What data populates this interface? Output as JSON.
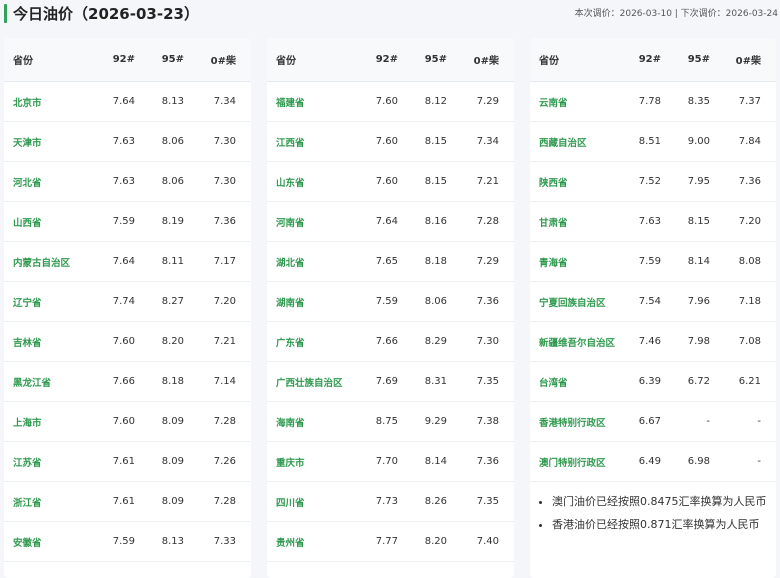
{
  "header": {
    "title": "今日油价（2026-03-23）",
    "adjust_info": "本次调价：2026-03-10 | 下次调价：2026-03-24"
  },
  "columns": {
    "province": "省份",
    "p92": "92#",
    "p95": "95#",
    "p0": "0#柴"
  },
  "tables": [
    {
      "rows": [
        {
          "province": "北京市",
          "p92": "7.64",
          "p95": "8.13",
          "p0": "7.34"
        },
        {
          "province": "天津市",
          "p92": "7.63",
          "p95": "8.06",
          "p0": "7.30"
        },
        {
          "province": "河北省",
          "p92": "7.63",
          "p95": "8.06",
          "p0": "7.30"
        },
        {
          "province": "山西省",
          "p92": "7.59",
          "p95": "8.19",
          "p0": "7.36"
        },
        {
          "province": "内蒙古自治区",
          "p92": "7.64",
          "p95": "8.11",
          "p0": "7.17"
        },
        {
          "province": "辽宁省",
          "p92": "7.74",
          "p95": "8.27",
          "p0": "7.20"
        },
        {
          "province": "吉林省",
          "p92": "7.60",
          "p95": "8.20",
          "p0": "7.21"
        },
        {
          "province": "黑龙江省",
          "p92": "7.66",
          "p95": "8.18",
          "p0": "7.14"
        },
        {
          "province": "上海市",
          "p92": "7.60",
          "p95": "8.09",
          "p0": "7.28"
        },
        {
          "province": "江苏省",
          "p92": "7.61",
          "p95": "8.09",
          "p0": "7.26"
        },
        {
          "province": "浙江省",
          "p92": "7.61",
          "p95": "8.09",
          "p0": "7.28"
        },
        {
          "province": "安徽省",
          "p92": "7.59",
          "p95": "8.13",
          "p0": "7.33"
        }
      ]
    },
    {
      "rows": [
        {
          "province": "福建省",
          "p92": "7.60",
          "p95": "8.12",
          "p0": "7.29"
        },
        {
          "province": "江西省",
          "p92": "7.60",
          "p95": "8.15",
          "p0": "7.34"
        },
        {
          "province": "山东省",
          "p92": "7.60",
          "p95": "8.15",
          "p0": "7.21"
        },
        {
          "province": "河南省",
          "p92": "7.64",
          "p95": "8.16",
          "p0": "7.28"
        },
        {
          "province": "湖北省",
          "p92": "7.65",
          "p95": "8.18",
          "p0": "7.29"
        },
        {
          "province": "湖南省",
          "p92": "7.59",
          "p95": "8.06",
          "p0": "7.36"
        },
        {
          "province": "广东省",
          "p92": "7.66",
          "p95": "8.29",
          "p0": "7.30"
        },
        {
          "province": "广西壮族自治区",
          "p92": "7.69",
          "p95": "8.31",
          "p0": "7.35"
        },
        {
          "province": "海南省",
          "p92": "8.75",
          "p95": "9.29",
          "p0": "7.38"
        },
        {
          "province": "重庆市",
          "p92": "7.70",
          "p95": "8.14",
          "p0": "7.36"
        },
        {
          "province": "四川省",
          "p92": "7.73",
          "p95": "8.26",
          "p0": "7.35"
        },
        {
          "province": "贵州省",
          "p92": "7.77",
          "p95": "8.20",
          "p0": "7.40"
        }
      ]
    },
    {
      "rows": [
        {
          "province": "云南省",
          "p92": "7.78",
          "p95": "8.35",
          "p0": "7.37"
        },
        {
          "province": "西藏自治区",
          "p92": "8.51",
          "p95": "9.00",
          "p0": "7.84"
        },
        {
          "province": "陕西省",
          "p92": "7.52",
          "p95": "7.95",
          "p0": "7.36"
        },
        {
          "province": "甘肃省",
          "p92": "7.63",
          "p95": "8.15",
          "p0": "7.20"
        },
        {
          "province": "青海省",
          "p92": "7.59",
          "p95": "8.14",
          "p0": "8.08"
        },
        {
          "province": "宁夏回族自治区",
          "p92": "7.54",
          "p95": "7.96",
          "p0": "7.18"
        },
        {
          "province": "新疆维吾尔自治区",
          "p92": "7.46",
          "p95": "7.98",
          "p0": "7.08"
        },
        {
          "province": "台湾省",
          "p92": "6.39",
          "p95": "6.72",
          "p0": "6.21"
        },
        {
          "province": "香港特别行政区",
          "p92": "6.67",
          "p95": "-",
          "p0": "-"
        },
        {
          "province": "澳门特别行政区",
          "p92": "6.49",
          "p95": "6.98",
          "p0": "-"
        }
      ]
    }
  ],
  "notes": [
    "澳门油价已经按照0.8475汇率换算为人民币",
    "香港油价已经按照0.871汇率换算为人民币"
  ]
}
